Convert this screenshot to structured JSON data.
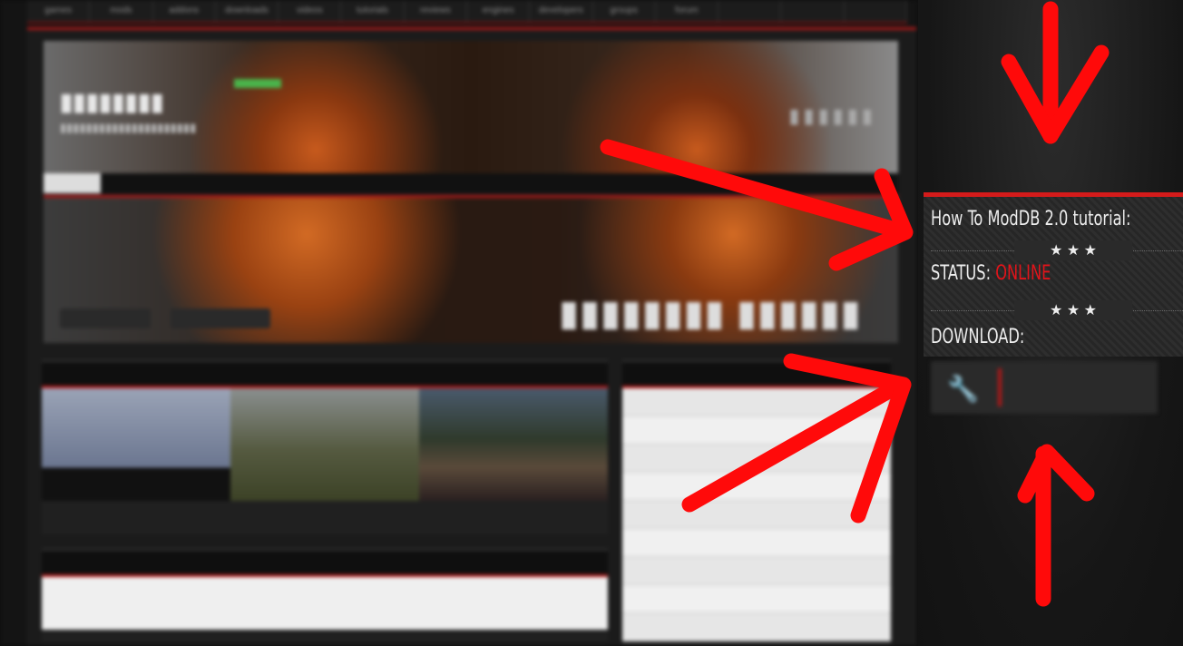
{
  "blurred_page": {
    "topnav": [
      "games",
      "mods",
      "addons",
      "downloads",
      "videos",
      "tutorials",
      "reviews",
      "engines",
      "developers",
      "groups",
      "forum",
      "",
      "",
      ""
    ],
    "profile_tabs": [
      "",
      "",
      "",
      "",
      "",
      "",
      "",
      "",
      "",
      "",
      "",
      "",
      "",
      "",
      ""
    ],
    "panel_left_title": "",
    "panel_right_title": "",
    "panel_bottom_title": ""
  },
  "info": {
    "title": "How To ModDB 2.0 tutorial:",
    "stars": "★ ★ ★",
    "status_label": "STATUS: ",
    "status_value": "ONLINE",
    "download_label": "DOWNLOAD:"
  },
  "download_button": {
    "icon": "wrench-icon",
    "title": "",
    "subtitle": ""
  },
  "colors": {
    "accent_red": "#d41b1b",
    "status_online": "#e0141a",
    "arrow_red": "#ff0a0a",
    "box_bg": "#2a2a2a"
  }
}
